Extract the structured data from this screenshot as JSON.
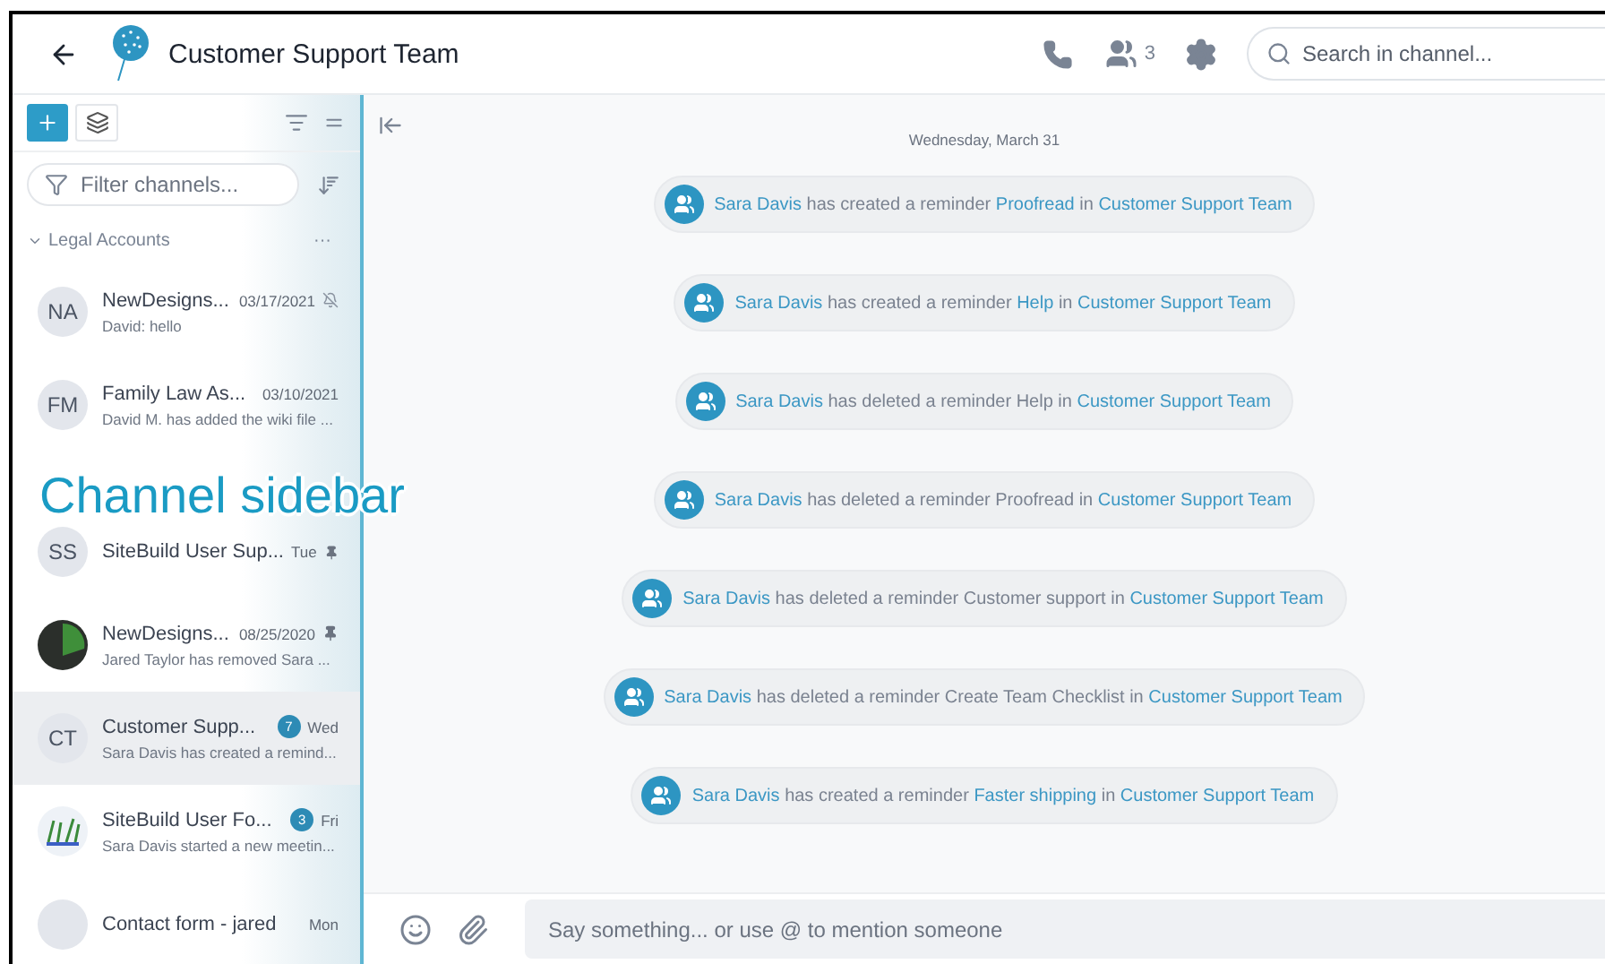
{
  "header": {
    "title": "Customer Support Team",
    "member_count": "3",
    "search": {
      "placeholder": "Search in channel..."
    }
  },
  "sidebar": {
    "filter": {
      "placeholder": "Filter channels..."
    },
    "group": {
      "label": "Legal Accounts",
      "expanded": true,
      "more": "···"
    },
    "sections": [
      {
        "channels": [
          {
            "kind": "initials",
            "initials": "NA",
            "name": "NewDesigns...",
            "time": "03/17/2021",
            "preview": "David: hello",
            "muted": true,
            "pinned": false,
            "selected": false
          },
          {
            "kind": "initials",
            "initials": "FM",
            "name": "Family Law As...",
            "time": "03/10/2021",
            "preview": "David M. has added the wiki file ...",
            "muted": false,
            "pinned": false,
            "selected": false
          }
        ]
      },
      {
        "channels": [
          {
            "kind": "initials",
            "initials": "SS",
            "name": "SiteBuild User Sup...",
            "time": "Tue",
            "muted": false,
            "pinned": true,
            "selected": false
          },
          {
            "kind": "photo",
            "name": "NewDesigns...",
            "time": "08/25/2020",
            "preview": "Jared Taylor has removed Sara ...",
            "muted": false,
            "pinned": true,
            "selected": false
          },
          {
            "kind": "initials",
            "initials": "CT",
            "name": "Customer Supp...",
            "time": "Wed",
            "preview": "Sara Davis has created a remind...",
            "unread": "7",
            "muted": false,
            "pinned": false,
            "selected": true
          },
          {
            "kind": "drawing",
            "name": "SiteBuild User Fo...",
            "time": "Fri",
            "preview": "Sara Davis started a new meetin...",
            "unread": "3",
            "muted": false,
            "pinned": false,
            "selected": false
          },
          {
            "kind": "blank",
            "name": "Contact form - jared",
            "time": "Mon",
            "muted": false,
            "pinned": false,
            "selected": false
          }
        ]
      }
    ]
  },
  "callout": {
    "label": "Channel sidebar"
  },
  "chat": {
    "date": "Wednesday, March 31",
    "events": [
      {
        "segments": [
          {
            "kind": "link",
            "text": "Sara Davis"
          },
          {
            "kind": "plain",
            "text": "has created a reminder"
          },
          {
            "kind": "link",
            "text": "Proofread"
          },
          {
            "kind": "plain",
            "text": "in"
          },
          {
            "kind": "link",
            "text": "Customer Support Team"
          }
        ]
      },
      {
        "segments": [
          {
            "kind": "link",
            "text": "Sara Davis"
          },
          {
            "kind": "plain",
            "text": "has created a reminder"
          },
          {
            "kind": "link",
            "text": "Help"
          },
          {
            "kind": "plain",
            "text": "in"
          },
          {
            "kind": "link",
            "text": "Customer Support Team"
          }
        ]
      },
      {
        "segments": [
          {
            "kind": "link",
            "text": "Sara Davis"
          },
          {
            "kind": "plain",
            "text": "has deleted a reminder Help in"
          },
          {
            "kind": "link",
            "text": "Customer Support Team"
          }
        ]
      },
      {
        "segments": [
          {
            "kind": "link",
            "text": "Sara Davis"
          },
          {
            "kind": "plain",
            "text": "has deleted a reminder Proofread in"
          },
          {
            "kind": "link",
            "text": "Customer Support Team"
          }
        ]
      },
      {
        "segments": [
          {
            "kind": "link",
            "text": "Sara Davis"
          },
          {
            "kind": "plain",
            "text": "has deleted a reminder Customer support in"
          },
          {
            "kind": "link",
            "text": "Customer Support Team"
          }
        ]
      },
      {
        "segments": [
          {
            "kind": "link",
            "text": "Sara Davis"
          },
          {
            "kind": "plain",
            "text": "has deleted a reminder Create Team Checklist in"
          },
          {
            "kind": "link",
            "text": "Customer Support Team"
          }
        ]
      },
      {
        "segments": [
          {
            "kind": "link",
            "text": "Sara Davis"
          },
          {
            "kind": "plain",
            "text": "has created a reminder"
          },
          {
            "kind": "link",
            "text": "Faster shipping"
          },
          {
            "kind": "plain",
            "text": "in"
          },
          {
            "kind": "link",
            "text": "Customer Support Team"
          }
        ]
      }
    ]
  },
  "composer": {
    "placeholder": "Say something... or use @ to mention someone"
  }
}
